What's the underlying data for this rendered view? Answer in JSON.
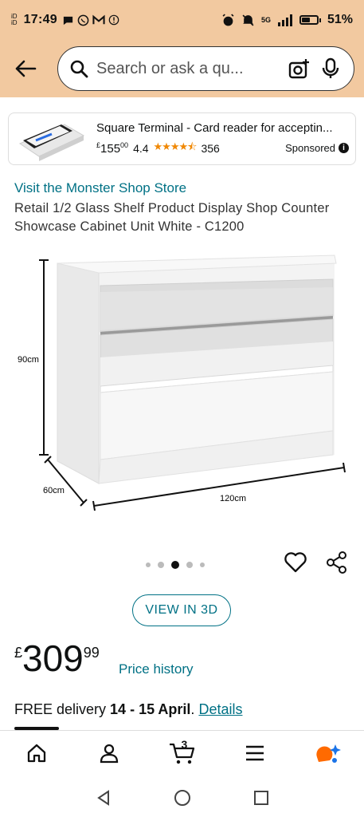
{
  "status_bar": {
    "sim1": "iD",
    "sim2": "iD",
    "time": "17:49",
    "network": "5G",
    "battery": "51%",
    "battery_level": 0.51
  },
  "header": {
    "search_placeholder": "Search or ask a qu..."
  },
  "ad": {
    "title": "Square Terminal - Card reader for acceptin...",
    "price_currency": "£",
    "price_whole": "155",
    "price_fraction": "00",
    "rating": "4.4",
    "stars_text": "★★★★⯪",
    "reviews": "356",
    "sponsored_label": "Sponsored",
    "info": "i"
  },
  "product": {
    "store_link": "Visit the Monster Shop Store",
    "title": "Retail 1/2 Glass Shelf Product Display Shop Counter Showcase Cabinet Unit White - C1200",
    "dim_height": "90cm",
    "dim_depth": "60cm",
    "dim_width": "120cm",
    "image_count": 5,
    "active_image_index": 2
  },
  "actions": {
    "view_3d": "VIEW IN 3D"
  },
  "price": {
    "currency": "£",
    "whole": "309",
    "fraction": "99",
    "history_link": "Price history"
  },
  "delivery": {
    "prefix": "FREE delivery",
    "dates": "14 - 15 April",
    "separator": ".",
    "details_link": "Details"
  },
  "nav": {
    "cart_count": "3"
  },
  "colors": {
    "header_bg": "#f2c9a0",
    "link": "#007185",
    "star": "#f08804",
    "rufus_orange": "#ff6a00",
    "rufus_blue": "#1a73e8"
  }
}
